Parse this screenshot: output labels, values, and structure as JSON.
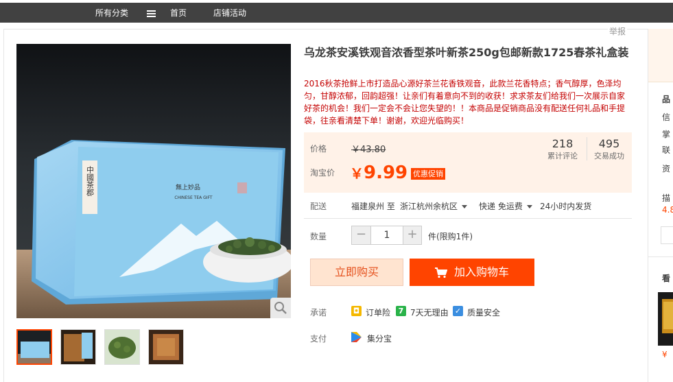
{
  "topnav": {
    "all_categories": "所有分类",
    "home": "首页",
    "shop_activity": "店铺活动"
  },
  "report_link": "举报",
  "product": {
    "title": "乌龙茶安溪铁观音浓香型茶叶新茶250g包邮新款1725春茶礼盒装",
    "subtitle": "2016秋茶抢鲜上市打造品心源好茶兰花香铁观音，此款兰花香特点；香气醇厚，色泽均匀，甘醇浓郁，回韵超强！让亲们有着意向不到的收获！求求茶友们给我们一次展示自家好茶的机会！我们一定会不会让您失望的！！本商品是促销商品没有配送任何礼品和手提袋，往亲看清楚下单！谢谢，欢迎光临购买！",
    "image_box_text_1": "中國茶郡",
    "image_box_text_2": "無上妙品",
    "image_box_text_3": "CHINESE TEA GIFT"
  },
  "price": {
    "label": "价格",
    "original": "￥43.80",
    "taobao_label": "淘宝价",
    "currency": "￥",
    "value": "9.99",
    "promo_badge": "优惠促销"
  },
  "stats": {
    "reviews_count": "218",
    "reviews_label": "累计评论",
    "sales_count": "495",
    "sales_label": "交易成功"
  },
  "shipping": {
    "label": "配送",
    "from": "福建泉州 至",
    "to": "浙江杭州余杭区",
    "method": "快递 免运费",
    "time": "24小时内发货"
  },
  "quantity": {
    "label": "数量",
    "minus": "−",
    "value": "1",
    "plus": "+",
    "limit": "件(限购1件)"
  },
  "buttons": {
    "buy_now": "立即购买",
    "add_to_cart": "加入购物车"
  },
  "promise": {
    "label": "承诺",
    "items": [
      "订单险",
      "7天无理由",
      "质量安全"
    ],
    "icon_7": "7"
  },
  "payment": {
    "label": "支付",
    "method": "集分宝"
  },
  "right_column": {
    "lines": [
      "品",
      "信",
      "掌",
      "联",
      "资",
      "描",
      "4.8",
      "看"
    ],
    "price_fragment": "¥"
  },
  "colors": {
    "accent": "#ff4400",
    "price": "#f40",
    "topbar": "#414141"
  }
}
